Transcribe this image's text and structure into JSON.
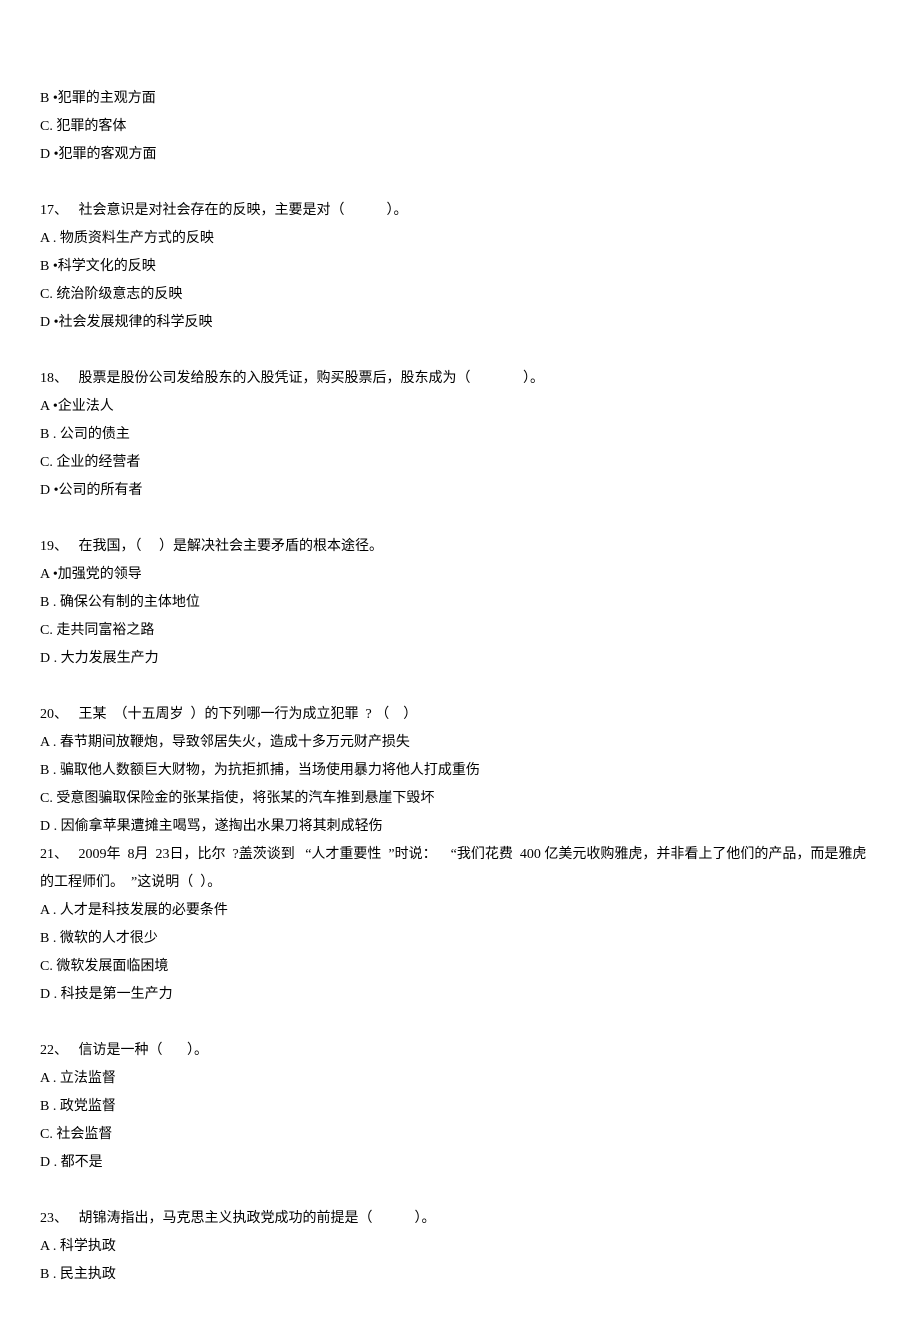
{
  "partial_q16": {
    "optB": "B •犯罪的主观方面",
    "optC": "C. 犯罪的客体",
    "optD": "D •犯罪的客观方面"
  },
  "q17": {
    "stem": "17、   社会意识是对社会存在的反映，主要是对（            ）。",
    "optA": "A . 物质资料生产方式的反映",
    "optB": "B •科学文化的反映",
    "optC": "C. 统治阶级意志的反映",
    "optD": "D •社会发展规律的科学反映"
  },
  "q18": {
    "stem": "18、   股票是股份公司发给股东的入股凭证，购买股票后，股东成为（               ）。",
    "optA": "A •企业法人",
    "optB": "B . 公司的债主",
    "optC": "C. 企业的经营者",
    "optD": "D •公司的所有者"
  },
  "q19": {
    "stem": "19、   在我国，（     ）是解决社会主要矛盾的根本途径。",
    "optA": "A •加强党的领导",
    "optB": "B . 确保公有制的主体地位",
    "optC": "C. 走共同富裕之路",
    "optD": "D . 大力发展生产力"
  },
  "q20": {
    "stem": "20、   王某  （十五周岁  ）的下列哪一行为成立犯罪  ? （    ）",
    "optA": "A . 春节期间放鞭炮，导致邻居失火，造成十多万元财产损失",
    "optB": "B . 骗取他人数额巨大财物，为抗拒抓捕，当场使用暴力将他人打成重伤",
    "optC": "C. 受意图骗取保险金的张某指使，将张某的汽车推到悬崖下毁坏",
    "optD": "D . 因偷拿苹果遭摊主喝骂，遂掏出水果刀将其刺成轻伤"
  },
  "q21": {
    "stem": "21、   2009年  8月  23日，比尔  ?盖茨谈到   “人才重要性  ”时说：    “我们花费  400 亿美元收购雅虎，并非看上了他们的产品，而是雅虎的工程师们。  ”这说明（  ）。",
    "optA": "A . 人才是科技发展的必要条件",
    "optB": "B . 微软的人才很少",
    "optC": "C. 微软发展面临困境",
    "optD": "D . 科技是第一生产力"
  },
  "q22": {
    "stem": "22、   信访是一种（       ）。",
    "optA": "A . 立法监督",
    "optB": "B . 政党监督",
    "optC": "C. 社会监督",
    "optD": "D . 都不是"
  },
  "q23": {
    "stem": "23、   胡锦涛指出，马克思主义执政党成功的前提是（            ）。",
    "optA": "A . 科学执政",
    "optB": "B . 民主执政"
  }
}
